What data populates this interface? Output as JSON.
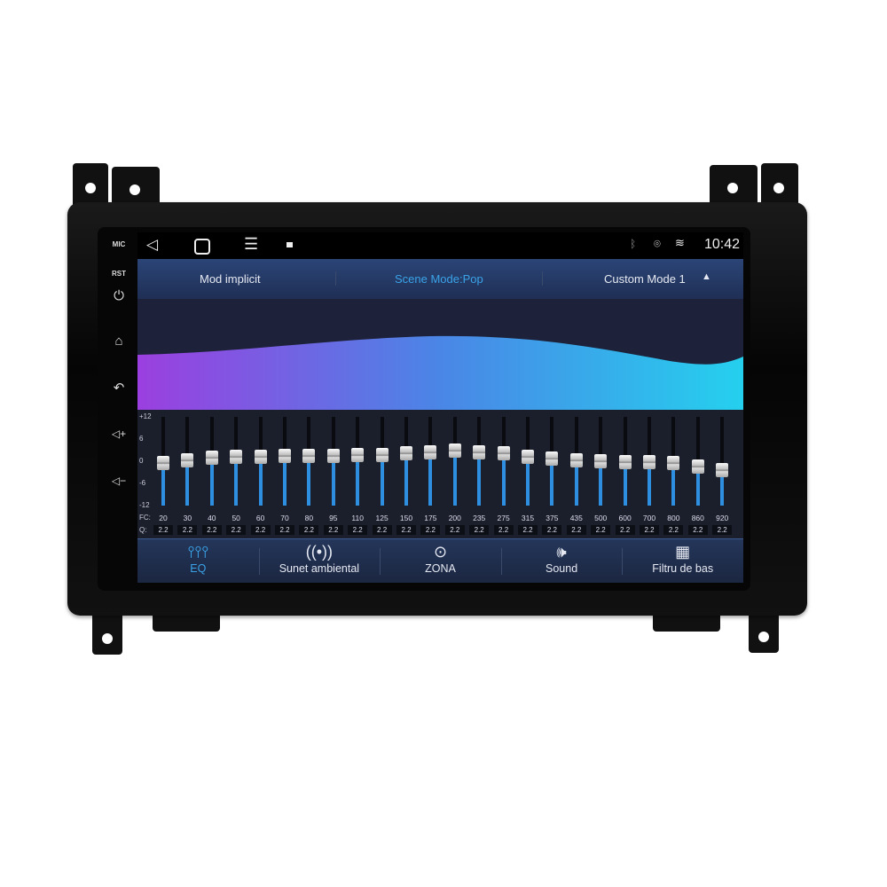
{
  "side_buttons": {
    "mic": "MIC",
    "rst": "RST"
  },
  "status_bar": {
    "time": "10:42",
    "icons": [
      "back-icon",
      "home-icon",
      "menu-icon",
      "gallery-icon",
      "bluetooth-icon",
      "location-icon",
      "wifi-icon"
    ]
  },
  "mode_bar": {
    "default_mode": "Mod implicit",
    "scene_mode": "Scene Mode:Pop",
    "custom_mode": "Custom Mode 1"
  },
  "colors": {
    "accent": "#2e8fe0",
    "active_tab": "#3aa3e8",
    "scene_mode": "#3aa3e8",
    "curve_start": "#9b3fe0",
    "curve_end": "#25d0ee"
  },
  "eq": {
    "axis_labels": [
      "+12",
      "6",
      "0",
      "-6",
      "-12"
    ],
    "range_db": [
      -12,
      12
    ],
    "fc_label": "FC:",
    "q_label": "Q:",
    "bands": [
      {
        "fc": "20",
        "q": "2.2",
        "gain": -0.5
      },
      {
        "fc": "30",
        "q": "2.2",
        "gain": 0.3
      },
      {
        "fc": "40",
        "q": "2.2",
        "gain": 1
      },
      {
        "fc": "50",
        "q": "2.2",
        "gain": 1.2
      },
      {
        "fc": "60",
        "q": "2.2",
        "gain": 1.2
      },
      {
        "fc": "70",
        "q": "2.2",
        "gain": 1.4
      },
      {
        "fc": "80",
        "q": "2.2",
        "gain": 1.4
      },
      {
        "fc": "95",
        "q": "2.2",
        "gain": 1.4
      },
      {
        "fc": "110",
        "q": "2.2",
        "gain": 1.7
      },
      {
        "fc": "125",
        "q": "2.2",
        "gain": 1.8
      },
      {
        "fc": "150",
        "q": "2.2",
        "gain": 2.2
      },
      {
        "fc": "175",
        "q": "2.2",
        "gain": 2.4
      },
      {
        "fc": "200",
        "q": "2.2",
        "gain": 3
      },
      {
        "fc": "235",
        "q": "2.2",
        "gain": 2.5
      },
      {
        "fc": "275",
        "q": "2.2",
        "gain": 2.2
      },
      {
        "fc": "315",
        "q": "2.2",
        "gain": 1.2
      },
      {
        "fc": "375",
        "q": "2.2",
        "gain": 0.7
      },
      {
        "fc": "435",
        "q": "2.2",
        "gain": 0.3
      },
      {
        "fc": "500",
        "q": "2.2",
        "gain": 0
      },
      {
        "fc": "600",
        "q": "2.2",
        "gain": -0.2
      },
      {
        "fc": "700",
        "q": "2.2",
        "gain": -0.2
      },
      {
        "fc": "800",
        "q": "2.2",
        "gain": -0.5
      },
      {
        "fc": "860",
        "q": "2.2",
        "gain": -1.4
      },
      {
        "fc": "920",
        "q": "2.2",
        "gain": -2.4
      }
    ]
  },
  "tabs": [
    {
      "label": "EQ",
      "icon": "equalizer-icon",
      "active": true
    },
    {
      "label": "Sunet ambiental",
      "icon": "surround-icon",
      "active": false
    },
    {
      "label": "ZONA",
      "icon": "target-icon",
      "active": false
    },
    {
      "label": "Sound",
      "icon": "speaker-icon",
      "active": false
    },
    {
      "label": "Filtru de bas",
      "icon": "bass-filter-icon",
      "active": false
    }
  ]
}
